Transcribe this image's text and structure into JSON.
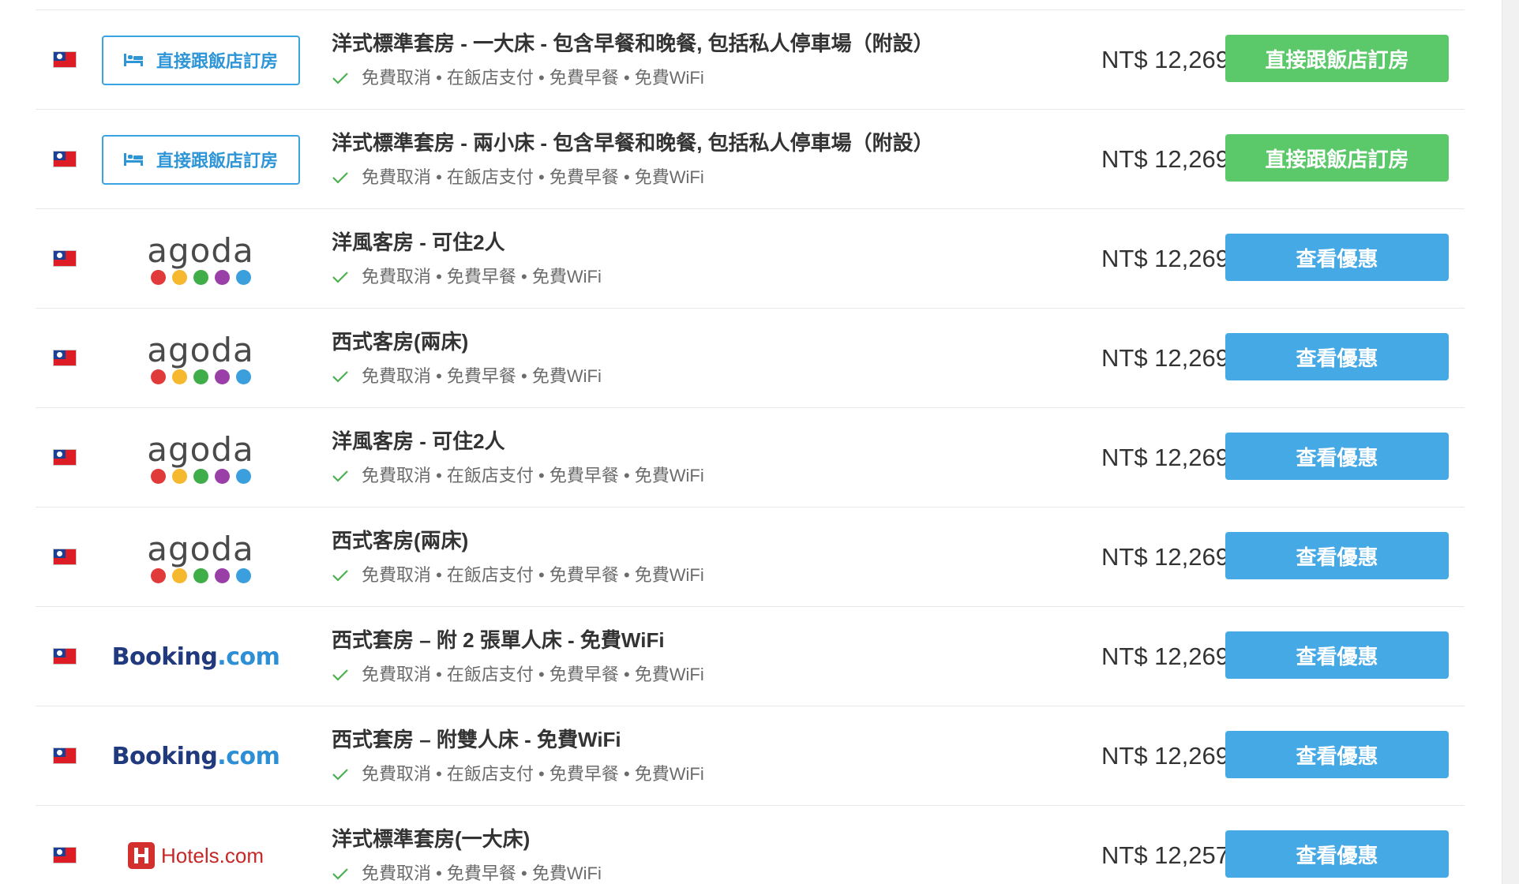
{
  "colors": {
    "direct_button": "#5bc86a",
    "deal_button": "#45a9e6",
    "direct_badge": "#3aa3e3",
    "check": "#4caf50"
  },
  "offers": [
    {
      "provider": "direct",
      "provider_label": "直接跟飯店訂房",
      "room": "洋式標準套房 - 一大床 - 包含早餐和晚餐, 包括私人停車場（附設）",
      "features": "免費取消 • 在飯店支付 • 免費早餐 • 免費WiFi",
      "price": "NT$ 12,269",
      "cta": "直接跟飯店訂房"
    },
    {
      "provider": "direct",
      "provider_label": "直接跟飯店訂房",
      "room": "洋式標準套房 - 兩小床 - 包含早餐和晚餐, 包括私人停車場（附設）",
      "features": "免費取消 • 在飯店支付 • 免費早餐 • 免費WiFi",
      "price": "NT$ 12,269",
      "cta": "直接跟飯店訂房"
    },
    {
      "provider": "agoda",
      "provider_label": "agoda",
      "room": "洋風客房 - 可住2人",
      "features": "免費取消 • 免費早餐 • 免費WiFi",
      "price": "NT$ 12,269",
      "cta": "查看優惠"
    },
    {
      "provider": "agoda",
      "provider_label": "agoda",
      "room": "西式客房(兩床)",
      "features": "免費取消 • 免費早餐 • 免費WiFi",
      "price": "NT$ 12,269",
      "cta": "查看優惠"
    },
    {
      "provider": "agoda",
      "provider_label": "agoda",
      "room": "洋風客房 - 可住2人",
      "features": "免費取消 • 在飯店支付 • 免費早餐 • 免費WiFi",
      "price": "NT$ 12,269",
      "cta": "查看優惠"
    },
    {
      "provider": "agoda",
      "provider_label": "agoda",
      "room": "西式客房(兩床)",
      "features": "免費取消 • 在飯店支付 • 免費早餐 • 免費WiFi",
      "price": "NT$ 12,269",
      "cta": "查看優惠"
    },
    {
      "provider": "booking",
      "provider_label": "Booking",
      "provider_label_suffix": ".com",
      "room": "西式套房 – 附 2 張單人床 - 免費WiFi",
      "features": "免費取消 • 在飯店支付 • 免費早餐 • 免費WiFi",
      "price": "NT$ 12,269",
      "cta": "查看優惠"
    },
    {
      "provider": "booking",
      "provider_label": "Booking",
      "provider_label_suffix": ".com",
      "room": "西式套房 – 附雙人床 - 免費WiFi",
      "features": "免費取消 • 在飯店支付 • 免費早餐 • 免費WiFi",
      "price": "NT$ 12,269",
      "cta": "查看優惠"
    },
    {
      "provider": "hotels",
      "provider_label": "Hotels.com",
      "room": "洋式標準套房(一大床)",
      "features": "免費取消 • 免費早餐 • 免費WiFi",
      "price": "NT$ 12,257",
      "cta": "查看優惠"
    }
  ]
}
